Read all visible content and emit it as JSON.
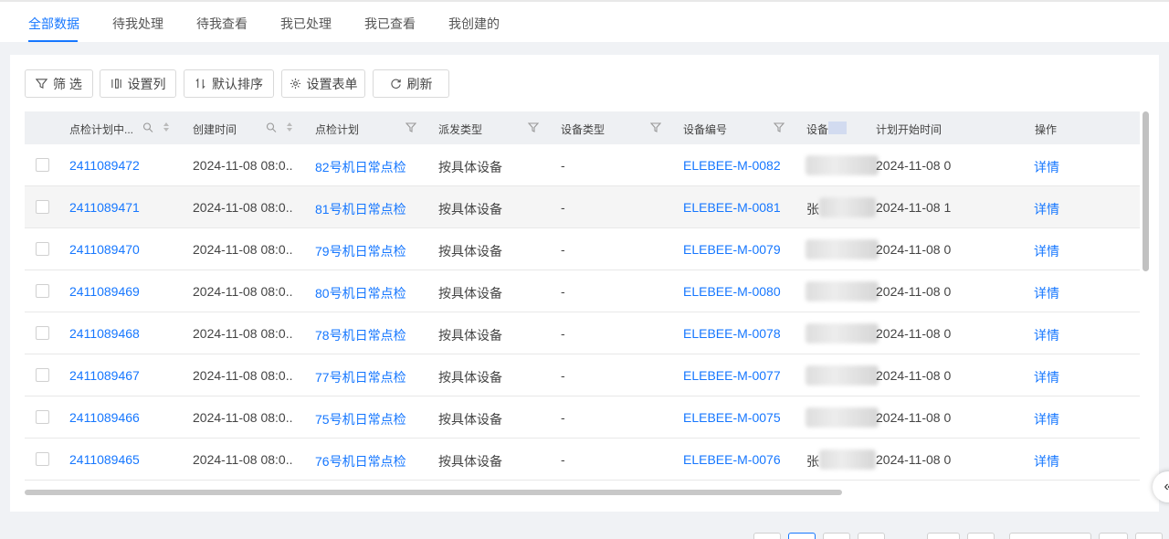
{
  "tabs": [
    "全部数据",
    "待我处理",
    "待我查看",
    "我已处理",
    "我已查看",
    "我创建的"
  ],
  "toolbar": {
    "filter": "筛 选",
    "set_columns": "设置列",
    "default_sort": "默认排序",
    "set_form": "设置表单",
    "refresh": "刷新"
  },
  "columns": {
    "plan_no": "点检计划中...",
    "created": "创建时间",
    "plan": "点检计划",
    "dispatch": "派发类型",
    "device_type": "设备类型",
    "device_no": "设备编号",
    "device_name": "设备",
    "start_time": "计划开始时间",
    "action": "操作"
  },
  "rows": [
    {
      "no": "2411089472",
      "created": "2024-11-08 08:0...",
      "plan": "82号机日常点检",
      "dispatch": "按具体设备",
      "device_type": "-",
      "device_no": "ELEBEE-M-0082",
      "device_name": "",
      "start": "2024-11-08 0",
      "action": "详情"
    },
    {
      "no": "2411089471",
      "created": "2024-11-08 08:0...",
      "plan": "81号机日常点检",
      "dispatch": "按具体设备",
      "device_type": "-",
      "device_no": "ELEBEE-M-0081",
      "device_name": "张",
      "start": "2024-11-08 1",
      "action": "详情"
    },
    {
      "no": "2411089470",
      "created": "2024-11-08 08:0...",
      "plan": "79号机日常点检",
      "dispatch": "按具体设备",
      "device_type": "-",
      "device_no": "ELEBEE-M-0079",
      "device_name": "",
      "start": "2024-11-08 0",
      "action": "详情"
    },
    {
      "no": "2411089469",
      "created": "2024-11-08 08:0...",
      "plan": "80号机日常点检",
      "dispatch": "按具体设备",
      "device_type": "-",
      "device_no": "ELEBEE-M-0080",
      "device_name": "",
      "start": "2024-11-08 0",
      "action": "详情"
    },
    {
      "no": "2411089468",
      "created": "2024-11-08 08:0...",
      "plan": "78号机日常点检",
      "dispatch": "按具体设备",
      "device_type": "-",
      "device_no": "ELEBEE-M-0078",
      "device_name": "",
      "start": "2024-11-08 0",
      "action": "详情"
    },
    {
      "no": "2411089467",
      "created": "2024-11-08 08:0...",
      "plan": "77号机日常点检",
      "dispatch": "按具体设备",
      "device_type": "-",
      "device_no": "ELEBEE-M-0077",
      "device_name": "",
      "start": "2024-11-08 0",
      "action": "详情"
    },
    {
      "no": "2411089466",
      "created": "2024-11-08 08:0...",
      "plan": "75号机日常点检",
      "dispatch": "按具体设备",
      "device_type": "-",
      "device_no": "ELEBEE-M-0075",
      "device_name": "",
      "start": "2024-11-08 0",
      "action": "详情"
    },
    {
      "no": "2411089465",
      "created": "2024-11-08 08:0...",
      "plan": "76号机日常点检",
      "dispatch": "按具体设备",
      "device_type": "-",
      "device_no": "ELEBEE-M-0076",
      "device_name": "张",
      "start": "2024-11-08 0",
      "action": "详情"
    }
  ],
  "collapse_icon": "«",
  "colors": {
    "accent": "#1677ff",
    "header_bg": "#eef0f3",
    "page_bg": "#f0f2f5"
  }
}
